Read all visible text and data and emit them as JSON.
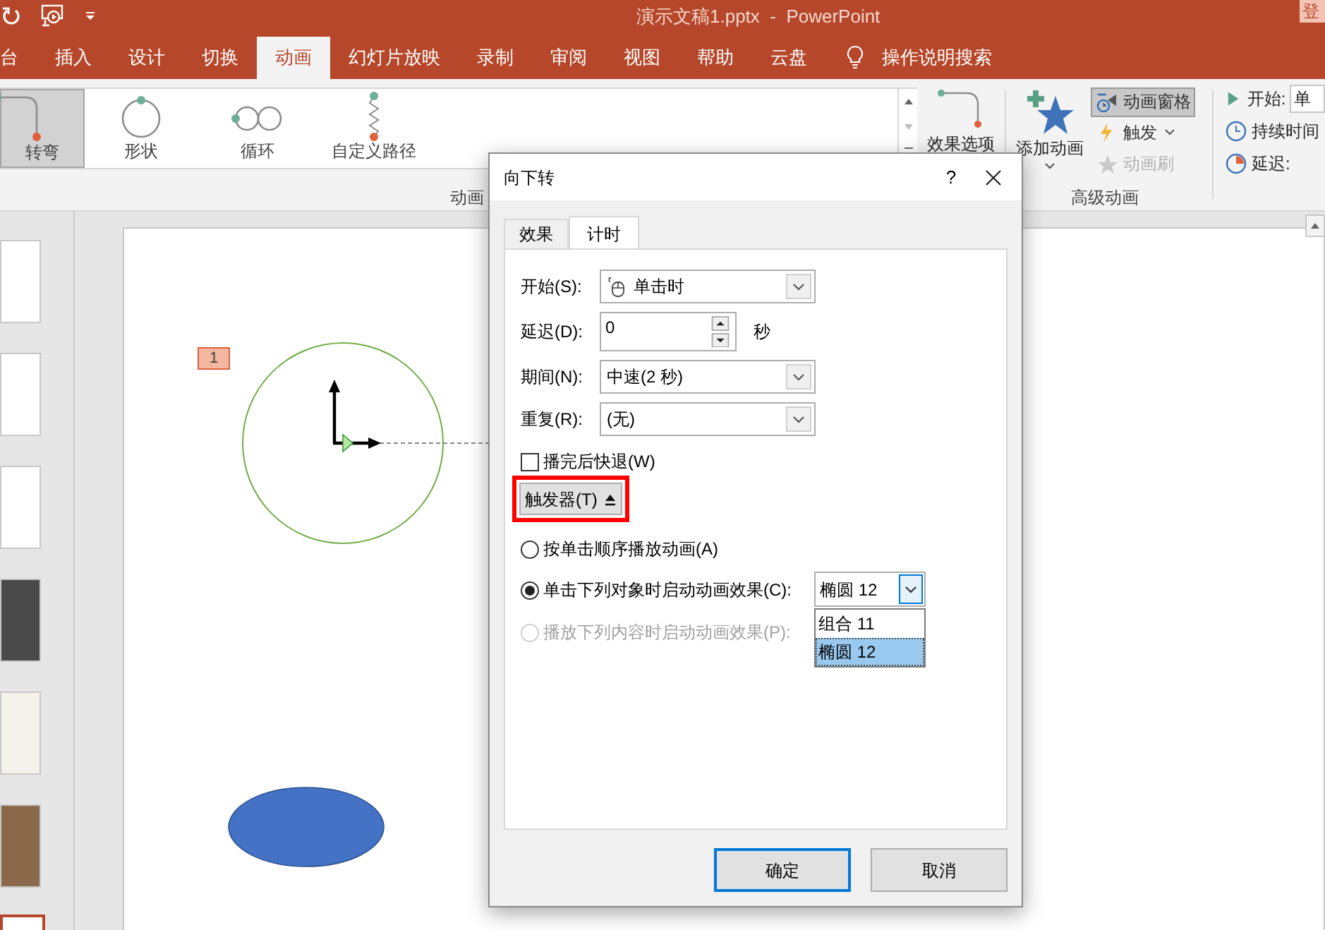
{
  "title_bar": {
    "title": "演示文稿1.pptx  -  PowerPoint",
    "account_button": "登"
  },
  "ribbon_tabs": [
    {
      "label": "台",
      "selected": false
    },
    {
      "label": "插入",
      "selected": false
    },
    {
      "label": "设计",
      "selected": false
    },
    {
      "label": "切换",
      "selected": false
    },
    {
      "label": "动画",
      "selected": true
    },
    {
      "label": "幻灯片放映",
      "selected": false
    },
    {
      "label": "录制",
      "selected": false
    },
    {
      "label": "审阅",
      "selected": false
    },
    {
      "label": "视图",
      "selected": false
    },
    {
      "label": "帮助",
      "selected": false
    },
    {
      "label": "云盘",
      "selected": false
    }
  ],
  "search_tab": "操作说明搜索",
  "animation_gallery": {
    "items": [
      {
        "kind": "turn",
        "label": "转弯",
        "selected": true
      },
      {
        "kind": "shape",
        "label": "形状",
        "selected": false
      },
      {
        "kind": "loop",
        "label": "循环",
        "selected": false
      },
      {
        "kind": "custom",
        "label": "自定义路径",
        "selected": false
      }
    ],
    "effect_options": "效果选项",
    "group_label": "动画"
  },
  "advanced_animation": {
    "add_animation": "添加动画",
    "buttons": [
      {
        "kind": "pane",
        "label": "动画窗格",
        "selected": true,
        "disabled": false
      },
      {
        "kind": "trigger",
        "label": "触发",
        "selected": false,
        "disabled": false
      },
      {
        "kind": "painter",
        "label": "动画刷",
        "selected": false,
        "disabled": true
      }
    ],
    "group_label": "高级动画"
  },
  "timing": [
    {
      "kind": "start",
      "label": "开始:",
      "value": "单"
    },
    {
      "kind": "duration",
      "label": "持续时间"
    },
    {
      "kind": "delay",
      "label": "延迟:"
    }
  ],
  "slide": {
    "badge": "1"
  },
  "dialog": {
    "title": "向下转",
    "help": "?",
    "tabs": [
      {
        "label": "效果",
        "selected": false
      },
      {
        "label": "计时",
        "selected": true
      }
    ],
    "fields": [
      {
        "kind": "mouse_combo",
        "label": "开始(S):",
        "value": "单击时"
      },
      {
        "kind": "spin",
        "label": "延迟(D):",
        "value": "0",
        "unit": "秒"
      },
      {
        "kind": "combo",
        "label": "期间(N):",
        "value": "中速(2 秒)"
      },
      {
        "kind": "combo",
        "label": "重复(R):",
        "value": "(无)"
      }
    ],
    "rewind": {
      "label": "播完后快退(W)",
      "checked": false
    },
    "triggers": {
      "label": "触发器(T)",
      "expanded": true,
      "highlighted": true
    },
    "trigger_options": [
      {
        "label": "按单击顺序播放动画(A)",
        "selected": false,
        "disabled": false
      },
      {
        "label": "单击下列对象时启动动画效果(C):",
        "selected": true,
        "disabled": false
      },
      {
        "label": "播放下列内容时启动动画效果(P):",
        "selected": false,
        "disabled": true
      }
    ],
    "trigger_object": {
      "value": "椭圆 12",
      "options": [
        {
          "label": "组合 11",
          "selected": false
        },
        {
          "label": "椭圆 12",
          "selected": true
        }
      ]
    },
    "buttons": [
      {
        "label": "确定",
        "default": true
      },
      {
        "label": "取消",
        "default": false
      }
    ]
  }
}
